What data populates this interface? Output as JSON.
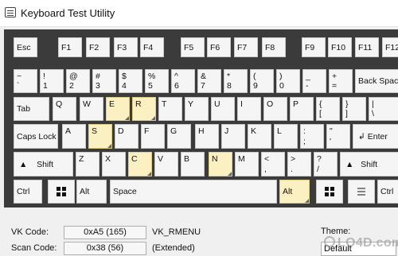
{
  "window": {
    "title": "Keyboard Test Utility"
  },
  "keys": {
    "esc": "Esc",
    "f1": "F1",
    "f2": "F2",
    "f3": "F3",
    "f4": "F4",
    "f5": "F5",
    "f6": "F6",
    "f7": "F7",
    "f8": "F8",
    "f9": "F9",
    "f10": "F10",
    "f11": "F11",
    "f12": "F12",
    "backtick": {
      "top": "~",
      "bottom": "`"
    },
    "d1": {
      "top": "!",
      "bottom": "1"
    },
    "d2": {
      "top": "@",
      "bottom": "2"
    },
    "d3": {
      "top": "#",
      "bottom": "3"
    },
    "d4": {
      "top": "$",
      "bottom": "4"
    },
    "d5": {
      "top": "%",
      "bottom": "5"
    },
    "d6": {
      "top": "^",
      "bottom": "6"
    },
    "d7": {
      "top": "&",
      "bottom": "7"
    },
    "d8": {
      "top": "*",
      "bottom": "8"
    },
    "d9": {
      "top": "(",
      "bottom": "9"
    },
    "d0": {
      "top": ")",
      "bottom": "0"
    },
    "minus": {
      "top": "_",
      "bottom": "-"
    },
    "equals": {
      "top": "+",
      "bottom": "="
    },
    "backspace": "Back Space",
    "tab": "Tab",
    "q": "Q",
    "w": "W",
    "e": "E",
    "r": "R",
    "t": "T",
    "y": "Y",
    "u": "U",
    "i": "I",
    "o": "O",
    "p": "P",
    "lbracket": {
      "top": "{",
      "bottom": "["
    },
    "rbracket": {
      "top": "}",
      "bottom": "]"
    },
    "backslash": {
      "top": "|",
      "bottom": "\\"
    },
    "capslock": "Caps Lock",
    "a": "A",
    "s": "S",
    "d": "D",
    "f": "F",
    "g": "G",
    "h": "H",
    "j": "J",
    "k": "K",
    "l": "L",
    "semicolon": {
      "top": ":",
      "bottom": ";"
    },
    "quote": {
      "top": "\"",
      "bottom": "'"
    },
    "enter": "Enter",
    "shift_left": "Shift",
    "z": "Z",
    "x": "X",
    "c": "C",
    "v": "V",
    "b": "B",
    "n": "N",
    "m": "M",
    "comma": {
      "top": "<",
      "bottom": ","
    },
    "period": {
      "top": ">",
      "bottom": "."
    },
    "slash": {
      "top": "?",
      "bottom": "/"
    },
    "shift_right": "Shift",
    "ctrl_left": "Ctrl",
    "alt_left": "Alt",
    "space": "Space",
    "alt_right": "Alt",
    "ctrl_right": "Ctrl"
  },
  "highlighted_keys": [
    "E",
    "R",
    "S",
    "C",
    "N",
    "Alt (right)"
  ],
  "highlight_color": "#fbf0c2",
  "keyboard_background": "#3b3b3b",
  "info": {
    "vk_label": "VK Code:",
    "vk_value": "0xA5 (165)",
    "vk_name": "VK_RMENU",
    "scan_label": "Scan Code:",
    "scan_value": "0x38 (56)",
    "scan_extra": "(Extended)",
    "theme_label": "Theme:",
    "theme_value": "Default"
  },
  "watermark": "LO4D.com"
}
